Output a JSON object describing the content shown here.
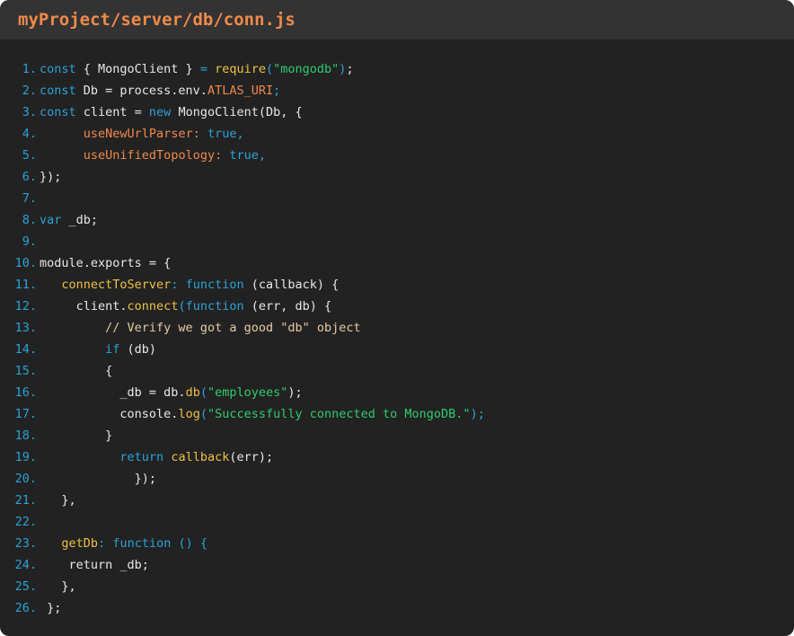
{
  "window": {
    "title": "myProject/server/db/conn.js"
  },
  "colors": {
    "background": "#222222",
    "titlebar": "#333333",
    "title": "#f08a4b",
    "line_number": "#2aa3d8",
    "plain": "#e8e8e8",
    "keyword": "#2aa3d8",
    "function": "#f0c040",
    "string": "#2ecc71",
    "property": "#f08a4b",
    "comment": "#e8c9a8"
  },
  "code": {
    "lines": [
      {
        "num": "1.",
        "tokens": [
          {
            "t": "kw",
            "v": "const"
          },
          {
            "t": "plain",
            "v": " { MongoClient } "
          },
          {
            "t": "kw",
            "v": "="
          },
          {
            "t": "plain",
            "v": " "
          },
          {
            "t": "fn",
            "v": "require"
          },
          {
            "t": "kw",
            "v": "("
          },
          {
            "t": "str",
            "v": "\"mongodb\""
          },
          {
            "t": "kw",
            "v": ")"
          },
          {
            "t": "plain",
            "v": ";"
          }
        ]
      },
      {
        "num": "2.",
        "tokens": [
          {
            "t": "kw",
            "v": "const"
          },
          {
            "t": "plain",
            "v": " Db = process.env."
          },
          {
            "t": "prop",
            "v": "ATLAS_URI"
          },
          {
            "t": "kw",
            "v": ";"
          }
        ]
      },
      {
        "num": "3.",
        "tokens": [
          {
            "t": "kw",
            "v": "const"
          },
          {
            "t": "plain",
            "v": " client = "
          },
          {
            "t": "kw",
            "v": "new"
          },
          {
            "t": "plain",
            "v": " MongoClient(Db, {"
          }
        ]
      },
      {
        "num": "4.",
        "tokens": [
          {
            "t": "plain",
            "v": "      "
          },
          {
            "t": "prop",
            "v": "useNewUrlParser:"
          },
          {
            "t": "plain",
            "v": " "
          },
          {
            "t": "kw",
            "v": "true,"
          }
        ]
      },
      {
        "num": "5.",
        "tokens": [
          {
            "t": "plain",
            "v": "      "
          },
          {
            "t": "prop",
            "v": "useUnifiedTopology:"
          },
          {
            "t": "plain",
            "v": " "
          },
          {
            "t": "kw",
            "v": "true,"
          }
        ]
      },
      {
        "num": "6.",
        "tokens": [
          {
            "t": "plain",
            "v": "});"
          }
        ]
      },
      {
        "num": "7.",
        "tokens": []
      },
      {
        "num": "8.",
        "tokens": [
          {
            "t": "kw",
            "v": "var"
          },
          {
            "t": "plain",
            "v": " _db;"
          }
        ]
      },
      {
        "num": "9.",
        "tokens": []
      },
      {
        "num": "10.",
        "tokens": [
          {
            "t": "plain",
            "v": "module.exports = {"
          }
        ]
      },
      {
        "num": "11.",
        "tokens": [
          {
            "t": "plain",
            "v": "   "
          },
          {
            "t": "fn",
            "v": "connectToServer"
          },
          {
            "t": "kw",
            "v": ":"
          },
          {
            "t": "plain",
            "v": " "
          },
          {
            "t": "kw",
            "v": "function"
          },
          {
            "t": "plain",
            "v": " (callback) {"
          }
        ]
      },
      {
        "num": "12.",
        "tokens": [
          {
            "t": "plain",
            "v": "     client."
          },
          {
            "t": "fn",
            "v": "connect"
          },
          {
            "t": "kw",
            "v": "(function"
          },
          {
            "t": "plain",
            "v": " (err, db) {"
          }
        ]
      },
      {
        "num": "13.",
        "tokens": [
          {
            "t": "plain",
            "v": "         "
          },
          {
            "t": "comment",
            "v": "// Verify we got a good \"db\" object"
          }
        ]
      },
      {
        "num": "14.",
        "tokens": [
          {
            "t": "plain",
            "v": "         "
          },
          {
            "t": "kw",
            "v": "if"
          },
          {
            "t": "plain",
            "v": " (db)"
          }
        ]
      },
      {
        "num": "15.",
        "tokens": [
          {
            "t": "plain",
            "v": "         {"
          }
        ]
      },
      {
        "num": "16.",
        "tokens": [
          {
            "t": "plain",
            "v": "           _db = db."
          },
          {
            "t": "fn",
            "v": "db"
          },
          {
            "t": "kw",
            "v": "("
          },
          {
            "t": "str",
            "v": "\"employees\""
          },
          {
            "t": "plain",
            "v": ");"
          }
        ]
      },
      {
        "num": "17.",
        "tokens": [
          {
            "t": "plain",
            "v": "           console."
          },
          {
            "t": "fn",
            "v": "log"
          },
          {
            "t": "kw",
            "v": "("
          },
          {
            "t": "str",
            "v": "\"Successfully connected to MongoDB.\""
          },
          {
            "t": "kw",
            "v": ");"
          }
        ]
      },
      {
        "num": "18.",
        "tokens": [
          {
            "t": "plain",
            "v": "         }"
          }
        ]
      },
      {
        "num": "19.",
        "tokens": [
          {
            "t": "plain",
            "v": "           "
          },
          {
            "t": "kw",
            "v": "return"
          },
          {
            "t": "plain",
            "v": " "
          },
          {
            "t": "fn",
            "v": "callback"
          },
          {
            "t": "plain",
            "v": "(err);"
          }
        ]
      },
      {
        "num": "20.",
        "tokens": [
          {
            "t": "plain",
            "v": "             });"
          }
        ]
      },
      {
        "num": "21.",
        "tokens": [
          {
            "t": "plain",
            "v": "   },"
          }
        ]
      },
      {
        "num": "22.",
        "tokens": []
      },
      {
        "num": "23.",
        "tokens": [
          {
            "t": "plain",
            "v": "   "
          },
          {
            "t": "fn",
            "v": "getDb"
          },
          {
            "t": "kw",
            "v": ":"
          },
          {
            "t": "plain",
            "v": " "
          },
          {
            "t": "kw",
            "v": "function"
          },
          {
            "t": "plain",
            "v": " "
          },
          {
            "t": "kw",
            "v": "() {"
          }
        ]
      },
      {
        "num": "24.",
        "tokens": [
          {
            "t": "plain",
            "v": "    return _db;"
          }
        ]
      },
      {
        "num": "25.",
        "tokens": [
          {
            "t": "plain",
            "v": "   },"
          }
        ]
      },
      {
        "num": "26.",
        "tokens": [
          {
            "t": "plain",
            "v": " };"
          }
        ]
      }
    ]
  }
}
